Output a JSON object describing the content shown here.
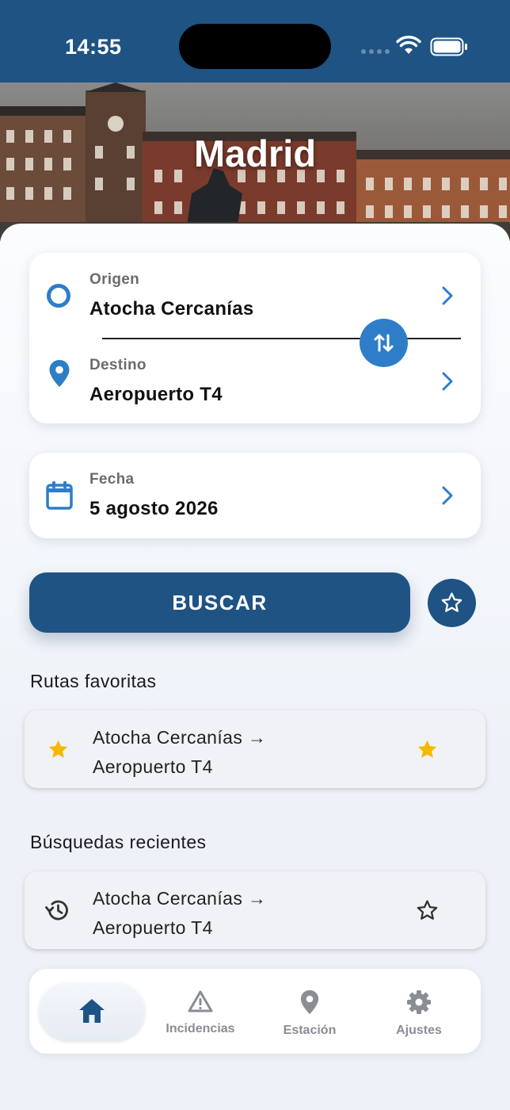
{
  "status_bar": {
    "time": "14:55"
  },
  "hero": {
    "city": "Madrid"
  },
  "route": {
    "origin_label": "Origen",
    "origin_value": "Atocha Cercanías",
    "destination_label": "Destino",
    "destination_value": "Aeropuerto T4"
  },
  "date": {
    "label": "Fecha",
    "value": "5 agosto 2026"
  },
  "actions": {
    "search_label": "BUSCAR"
  },
  "favorites": {
    "title": "Rutas favoritas",
    "items": [
      {
        "line1": "Atocha Cercanías →",
        "line2": "Aeropuerto T4",
        "starred": true
      }
    ]
  },
  "recent": {
    "title": "Búsquedas recientes",
    "items": [
      {
        "line1": "Atocha Cercanías →",
        "line2": "Aeropuerto T4",
        "starred": false
      }
    ]
  },
  "nav": {
    "items": [
      {
        "label": "",
        "icon": "home-icon",
        "active": true
      },
      {
        "label": "Incidencias",
        "icon": "warning-icon",
        "active": false
      },
      {
        "label": "Estación",
        "icon": "location-pin-icon",
        "active": false
      },
      {
        "label": "Ajustes",
        "icon": "gear-icon",
        "active": false
      }
    ]
  },
  "colors": {
    "primary": "#1e5384",
    "accent": "#2e7dc8",
    "star": "#f5b800",
    "background": "#eef2f8"
  }
}
